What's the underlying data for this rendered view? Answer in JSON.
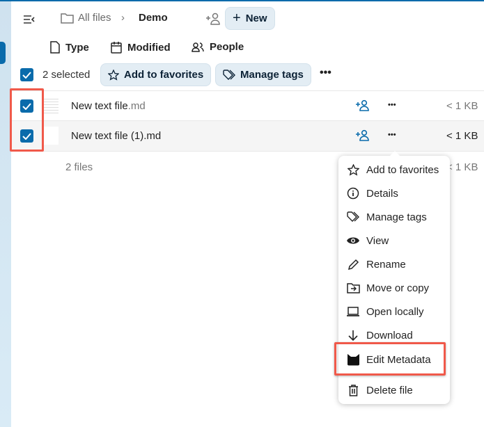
{
  "header": {
    "breadcrumb_root": "All files",
    "breadcrumb_current": "Demo",
    "new_label": "New"
  },
  "filters": {
    "type": "Type",
    "modified": "Modified",
    "people": "People"
  },
  "selection": {
    "count_label": "2 selected",
    "add_favorites": "Add to favorites",
    "manage_tags": "Manage tags"
  },
  "files": [
    {
      "name": "New text file",
      "ext": ".md",
      "size": "< 1 KB"
    },
    {
      "name": "New text file (1)",
      "ext": ".md",
      "size": "< 1 KB"
    }
  ],
  "footer": {
    "count": "2 files",
    "size": "< 1 KB"
  },
  "menu": {
    "items": [
      "Add to favorites",
      "Details",
      "Manage tags",
      "View",
      "Rename",
      "Move or copy",
      "Open locally",
      "Download",
      "Edit Metadata",
      "Delete file"
    ]
  },
  "colors": {
    "accent": "#0a6bab",
    "highlight": "#f0594a"
  }
}
